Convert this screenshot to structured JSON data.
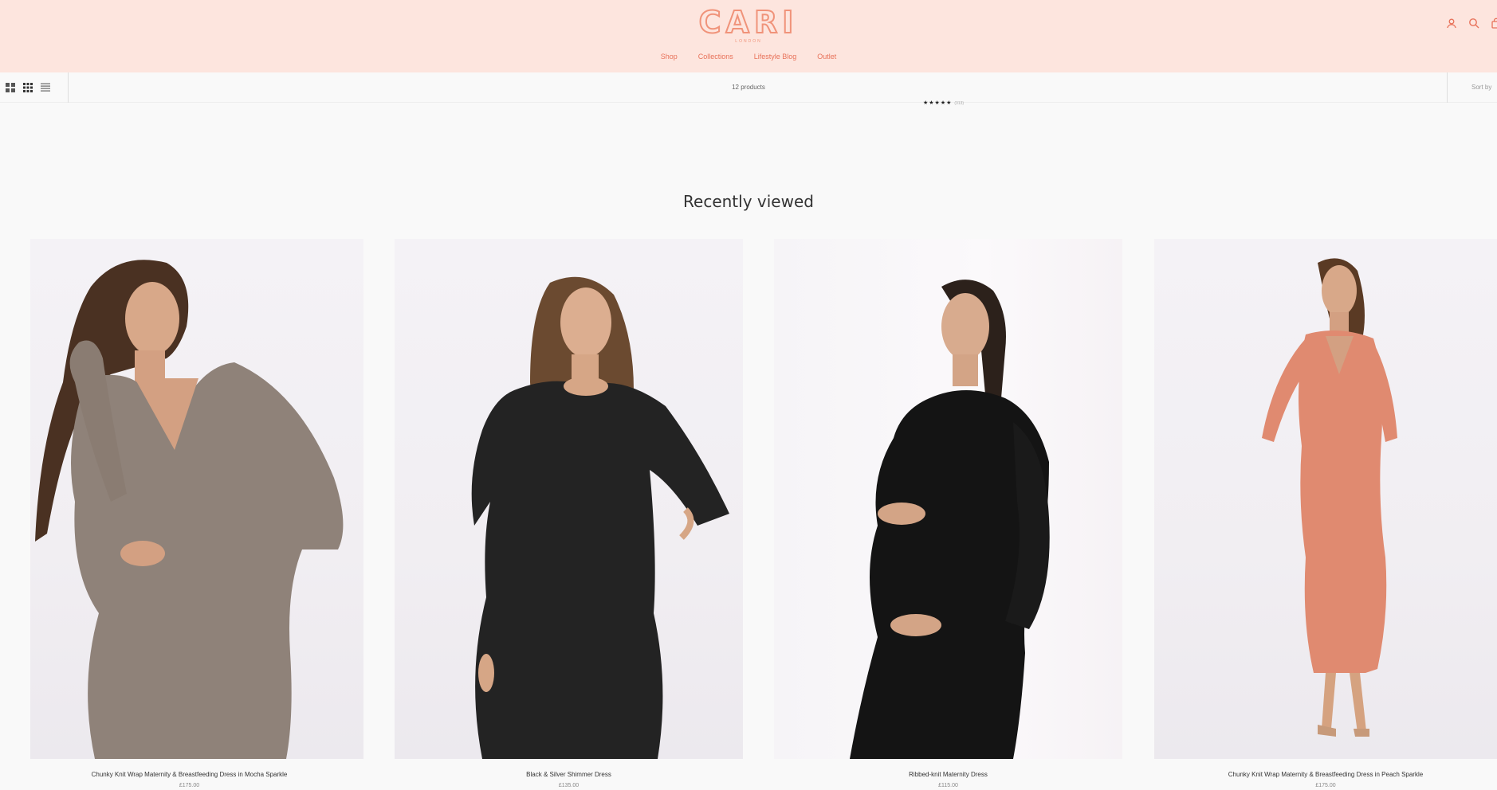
{
  "brand": {
    "name": "CARI",
    "sub": "LONDON",
    "accent_color": "#f0937a",
    "header_bg": "#fde5de"
  },
  "nav": {
    "items": [
      "Shop",
      "Collections",
      "Lifestyle Blog",
      "Outlet"
    ]
  },
  "header_icons": [
    "account-icon",
    "search-icon",
    "cart-icon"
  ],
  "toolbar": {
    "product_count": "12 products",
    "sort_label": "Sort by",
    "view_toggles": [
      "grid-2-icon",
      "grid-3-icon",
      "list-icon"
    ]
  },
  "review_snippet": {
    "stars": "★★★★★",
    "count": "(313)"
  },
  "recently_viewed": {
    "title": "Recently viewed",
    "products": [
      {
        "title": "Chunky Knit Wrap Maternity & Breastfeeding Dress in Mocha Sparkle",
        "price": "£175.00",
        "color": "#8f8279"
      },
      {
        "title": "Black & Silver Shimmer Dress",
        "price": "£135.00",
        "color": "#232323"
      },
      {
        "title": "Ribbed-knit Maternity Dress",
        "price": "£115.00",
        "color": "#141414"
      },
      {
        "title": "Chunky Knit Wrap Maternity & Breastfeeding Dress in Peach Sparkle",
        "price": "£175.00",
        "color": "#e08a70"
      }
    ]
  }
}
